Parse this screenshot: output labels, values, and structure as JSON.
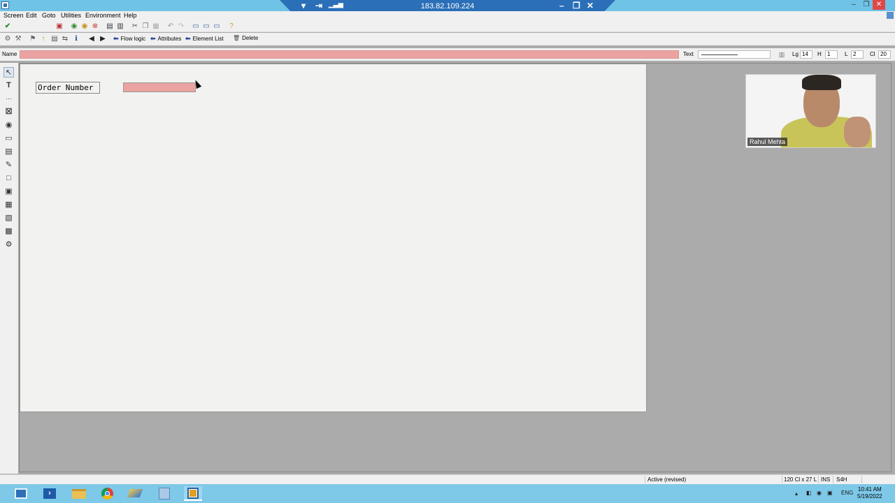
{
  "window": {
    "connection_ip": "183.82.109.224",
    "minimize": "–",
    "restore": "❐",
    "close": "✕"
  },
  "menu": [
    "Screen",
    "Edit",
    "Goto",
    "Utilities",
    "Environment",
    "Help"
  ],
  "toolbar2": {
    "flow_logic": "Flow logic",
    "attributes": "Attributes",
    "element_list": "Element List",
    "delete": "Delete"
  },
  "name_row": {
    "name_label": "Name",
    "text_label": "Text",
    "lg_label": "Lg",
    "lg_value": "14",
    "h_label": "H",
    "h_value": "1",
    "l_label": "L",
    "l_value": "2",
    "cl_label": "Cl",
    "cl_value": "20"
  },
  "canvas": {
    "label_text": "Order Number",
    "input_value": ""
  },
  "webcam": {
    "participant": "Rahul Mehta"
  },
  "status": {
    "state": "Active (revised)",
    "position": "120 Cl x 27 L",
    "mode": "INS",
    "system": "S4H"
  },
  "taskbar": {
    "lang": "ENG",
    "time": "10:41 AM",
    "date": "5/19/2022"
  },
  "colors": {
    "title_bar": "#6fc3e6",
    "required_field": "#eba3a1",
    "taskbar": "#7ec8e8"
  }
}
